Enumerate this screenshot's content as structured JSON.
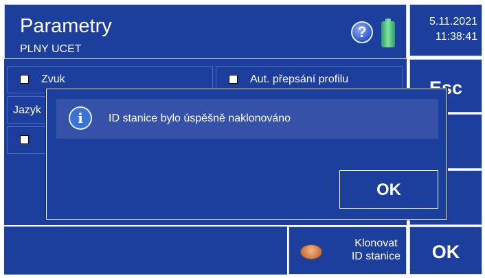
{
  "header": {
    "title": "Parametry",
    "subtitle": "PLNY UCET"
  },
  "datetime": {
    "date": "5.11.2021",
    "time": "11:38:41"
  },
  "sidebar": {
    "esc_label": "Esc",
    "up_glyph": "↑",
    "down_glyph": "↓",
    "ok_label": "OK"
  },
  "options": {
    "sound_label": "Zvuk",
    "auto_overwrite_label": "Aut. přepsání profilu",
    "language_label": "Jazyk"
  },
  "clone_button": {
    "line1": "Klonovat",
    "line2": "ID stanice"
  },
  "dialog": {
    "message": "ID stanice bylo úspěšně naklonováno",
    "ok_label": "OK",
    "info_glyph": "i"
  },
  "icons": {
    "help": "help-icon",
    "battery": "battery-icon",
    "info": "info-icon",
    "coin": "coin-icon"
  },
  "colors": {
    "panel": "#1c3f9e",
    "message_bar": "#3552a8",
    "battery": "#4cc27f"
  }
}
